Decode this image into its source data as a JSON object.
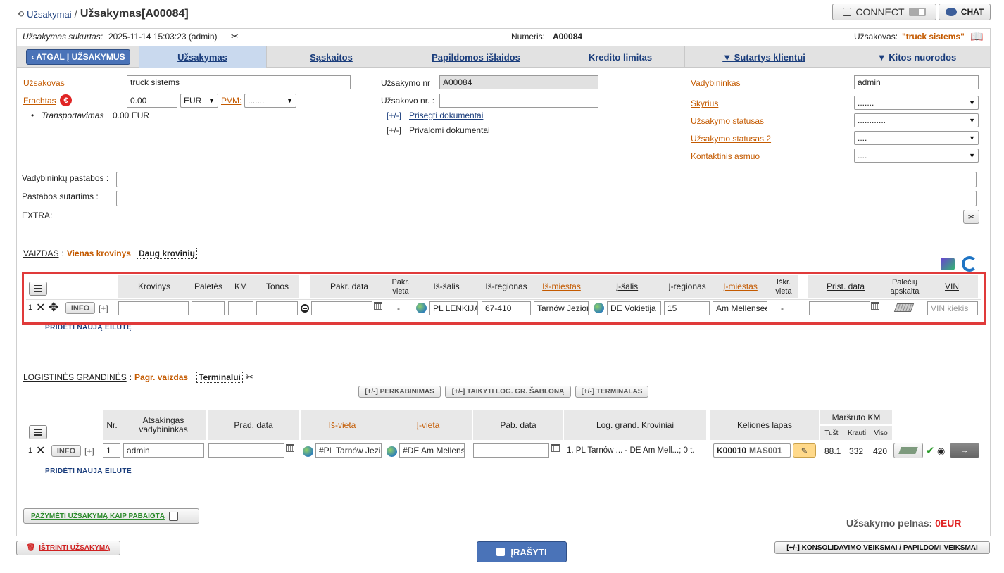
{
  "breadcrumb": {
    "parent": "Užsakymai",
    "sep": "/",
    "current": "Užsakymas[A00084]"
  },
  "topright": {
    "connect_label": "CONNECT",
    "chat_label": "CHAT"
  },
  "info_bar": {
    "created_label": "Užsakymas sukurtas:",
    "created_value": "2025-11-14 15:03:23 (admin)",
    "number_label": "Numeris:",
    "number_value": "A00084",
    "customer_label": "Užsakovas:",
    "customer_value": "\"truck sistems\""
  },
  "nav": {
    "back": "ATGAL Į UŽSAKYMUS",
    "tabs": [
      "Užsakymas",
      "Sąskaitos",
      "Papildomos išlaidos",
      "Kredito limitas",
      "▼ Sutartys klientui",
      "▼ Kitos nuorodos"
    ]
  },
  "form": {
    "customer_label": "Užsakovas",
    "customer_value": "truck sistems",
    "freight_label": "Frachtas",
    "freight_value": "0.00",
    "currency": "EUR",
    "vat_label": "PVM:",
    "vat_value": ".......",
    "transport_label": "Transportavimas",
    "transport_value": "0.00 EUR",
    "order_no_label": "Užsakymo nr",
    "order_no_value": "A00084",
    "customer_no_label": "Užsakovo nr. :",
    "customer_no_value": "",
    "attach_docs": "Prisegti dokumentai",
    "required_docs": "Privalomi dokumentai",
    "toggle": "[+/-]",
    "manager_label": "Vadybininkas",
    "manager_value": "admin",
    "department_label": "Skyrius",
    "department_value": ".......",
    "status_label": "Užsakymo statusas",
    "status_value": "............",
    "status2_label": "Užsakymo statusas 2",
    "status2_value": "....",
    "contact_label": "Kontaktinis asmuo",
    "contact_value": "....",
    "manager_notes_label": "Vadybininkų pastabos :",
    "contract_notes_label": "Pastabos sutartims :",
    "extra_label": "EXTRA:"
  },
  "view": {
    "label": "VAIZDAS",
    "single": "Vienas krovinys",
    "multi": "Daug krovinių"
  },
  "cargo": {
    "headers": [
      "Krovinys",
      "Paletės",
      "KM",
      "Tonos",
      "Pakr. data",
      "Pakr. vieta",
      "Iš-šalis",
      "Iš-regionas",
      "Iš-miestas",
      "Į-šalis",
      "Į-regionas",
      "Į-miestas",
      "Iškr. vieta",
      "Prist. data",
      "Palečių apskaita",
      "VIN"
    ],
    "row": {
      "num": "1",
      "info": "INFO",
      "plus": "[+]",
      "load_place": "-",
      "from_country": "PL LENKIJA",
      "from_region": "67-410",
      "from_city": "Tarnów Jeziorny",
      "to_country": "DE Vokietija",
      "to_region": "15",
      "to_city": "Am Mellensee",
      "unload_place": "-",
      "vin_placeholder": "VIN kiekis"
    },
    "add_row": "PRIDĖTI NAUJĄ EILUTĘ"
  },
  "logistics": {
    "label": "LOGISTINĖS GRANDINĖS",
    "basic": "Pagr. vaizdas",
    "terminal": "Terminalui",
    "actions": [
      "[+/-] PERKABINIMAS",
      "[+/-] TAIKYTI LOG. GR. ŠABLONĄ",
      "[+/-] TERMINALAS"
    ],
    "headers": [
      "Nr.",
      "Atsakingas vadybininkas",
      "Prad. data",
      "Iš-vieta",
      "Į-vieta",
      "Pab. data",
      "Log. grand. Kroviniai",
      "Kelionės lapas",
      "Maršruto KM"
    ],
    "km_sub": [
      "Tušti",
      "Krauti",
      "Viso"
    ],
    "row": {
      "num": "1",
      "info": "INFO",
      "plus": "[+]",
      "nr": "1",
      "manager": "admin",
      "from": "#PL Tarnów Jeziorny",
      "to": "#DE Am Mellensee",
      "cargo": "1. PL Tarnów ... - DE Am Mell...; 0 t.",
      "trip": "K00010",
      "trip2": "MAS001",
      "empty": "88.1",
      "loaded": "332",
      "total": "420"
    },
    "add_row": "PRIDĖTI NAUJĄ EILUTĘ"
  },
  "footer": {
    "complete": "PAŽYMĖTI UŽSAKYMĄ KAIP PABAIGTĄ",
    "profit_label": "Užsakymo pelnas:",
    "profit_value": "0EUR",
    "delete": "IŠTRINTI UŽSAKYMĄ",
    "save": "ĮRAŠYTI",
    "consolidate": "[+/-] KONSOLIDAVIMO VEIKSMAI / PAPILDOMI VEIKSMAI"
  },
  "colors": {
    "accent": "#4a73b8",
    "orange": "#c45a00",
    "red": "#e02424",
    "highlight": "#e03a3a"
  }
}
